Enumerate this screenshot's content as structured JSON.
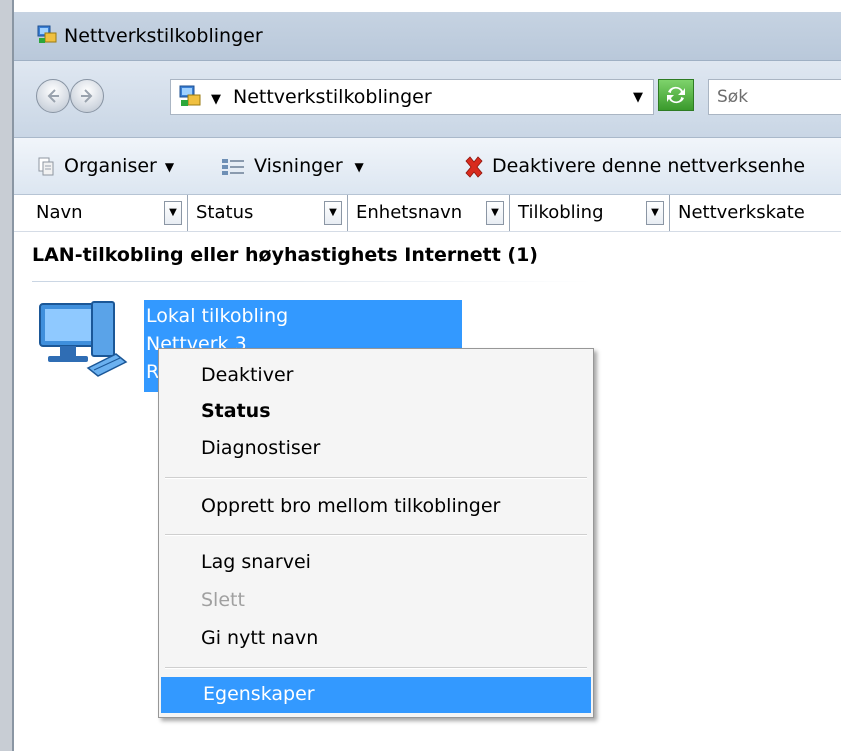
{
  "window": {
    "title": "Nettverkstilkoblinger"
  },
  "address": {
    "path": "Nettverkstilkoblinger",
    "search_placeholder": "Søk"
  },
  "toolbar": {
    "organise_label": "Organiser",
    "views_label": "Visninger",
    "disable_label": "Deaktivere denne nettverksenhe"
  },
  "columns": [
    {
      "label": "Navn"
    },
    {
      "label": "Status"
    },
    {
      "label": "Enhetsnavn"
    },
    {
      "label": "Tilkobling"
    },
    {
      "label": "Nettverkskate"
    }
  ],
  "group": {
    "header": "LAN-tilkobling eller høyhastighets Internett (1)"
  },
  "item": {
    "name": "Lokal tilkobling",
    "network": "Nettverk  3",
    "line3": "R"
  },
  "context_menu": {
    "items": [
      {
        "label": "Deaktiver"
      },
      {
        "label": "Status"
      },
      {
        "label": "Diagnostiser"
      },
      {
        "label": "Opprett bro mellom tilkoblinger"
      },
      {
        "label": "Lag snarvei"
      },
      {
        "label": "Slett"
      },
      {
        "label": "Gi nytt navn"
      },
      {
        "label": "Egenskaper"
      }
    ]
  },
  "colors": {
    "selection": "#3399ff",
    "menu_background": "#f5f5f5",
    "disabled_text": "#a0a0a0"
  },
  "icons": {
    "title": "network-connections-icon",
    "back": "back-arrow-icon",
    "forward": "forward-arrow-icon",
    "refresh": "refresh-icon",
    "organise": "organise-icon",
    "views": "views-icon",
    "disable": "red-x-icon",
    "item": "network-computer-icon"
  }
}
